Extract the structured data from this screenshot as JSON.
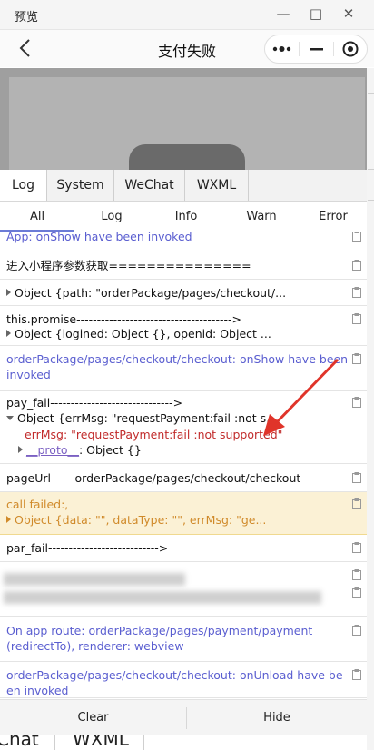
{
  "window": {
    "title": "预览"
  },
  "navbar": {
    "title": "支付失败"
  },
  "main_tabs": [
    "Log",
    "System",
    "WeChat",
    "WXML"
  ],
  "level_tabs": [
    "All",
    "Log",
    "Info",
    "Warn",
    "Error"
  ],
  "console": {
    "row1": "App: onShow have been invoked",
    "row2": "进入小程序参数获取===============",
    "row3": "Object {path: \"orderPackage/pages/checkout/...",
    "row4a": "this.promise-------------------------------------->",
    "row4b": "Object {logined: Object {}, openid: Object ...",
    "row5": "orderPackage/pages/checkout/checkout: onShow have been invoked",
    "row6a": "pay_fail------------------------------>",
    "row6b": "Object {errMsg: \"requestPayment:fail :not s...",
    "row6c_key": "errMsg: ",
    "row6c_val": "\"requestPayment:fail :not supported\"",
    "row6d_key": "__proto__",
    "row6d_val": ": Object {}",
    "row7": "pageUrl----- orderPackage/pages/checkout/checkout",
    "row8a": "call failed:,",
    "row8b": "Object {data: \"\", dataType: \"\", errMsg: \"ge...",
    "row9": "par_fail--------------------------->",
    "row10": "On app route: orderPackage/pages/payment/payment (redirectTo), renderer: webview",
    "row11": "orderPackage/pages/checkout/checkout: onUnload have been invoked"
  },
  "bottom": {
    "clear": "Clear",
    "hide": "Hide"
  },
  "under_tabs": [
    "Chat",
    "WXML"
  ],
  "colors": {
    "accent": "#6b7bd6",
    "link_blue": "#5a5ed0",
    "warn_bg": "#fbf1d5",
    "error_red": "#c12b2b",
    "arrow_red": "#e0342a"
  }
}
